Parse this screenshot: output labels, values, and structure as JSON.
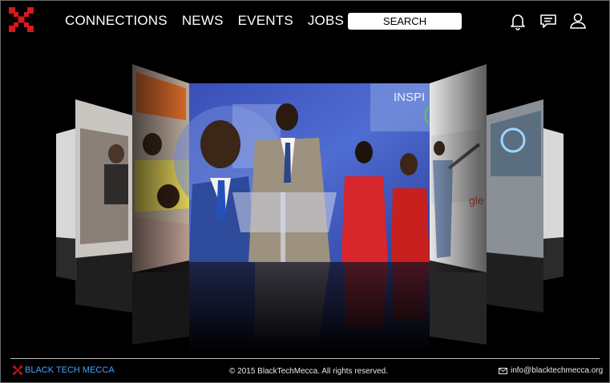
{
  "header": {
    "nav": [
      {
        "label": "CONNECTIONS"
      },
      {
        "label": "NEWS"
      },
      {
        "label": "EVENTS"
      },
      {
        "label": "JOBS"
      }
    ],
    "search_label": "SEARCH",
    "icons": [
      "bell-icon",
      "chat-icon",
      "user-icon"
    ],
    "logo_icon": "black-tech-mecca-logo",
    "accent_color": "#d6191c"
  },
  "carousel": {
    "featured_banner_text": "INSPI"
  },
  "footer": {
    "brand_label": "BLACK TECH MECCA",
    "copyright": "© 2015 BlackTechMecca. All rights reserved.",
    "email": "info@blacktechmecca.org",
    "link_color": "#4aa0ff"
  }
}
